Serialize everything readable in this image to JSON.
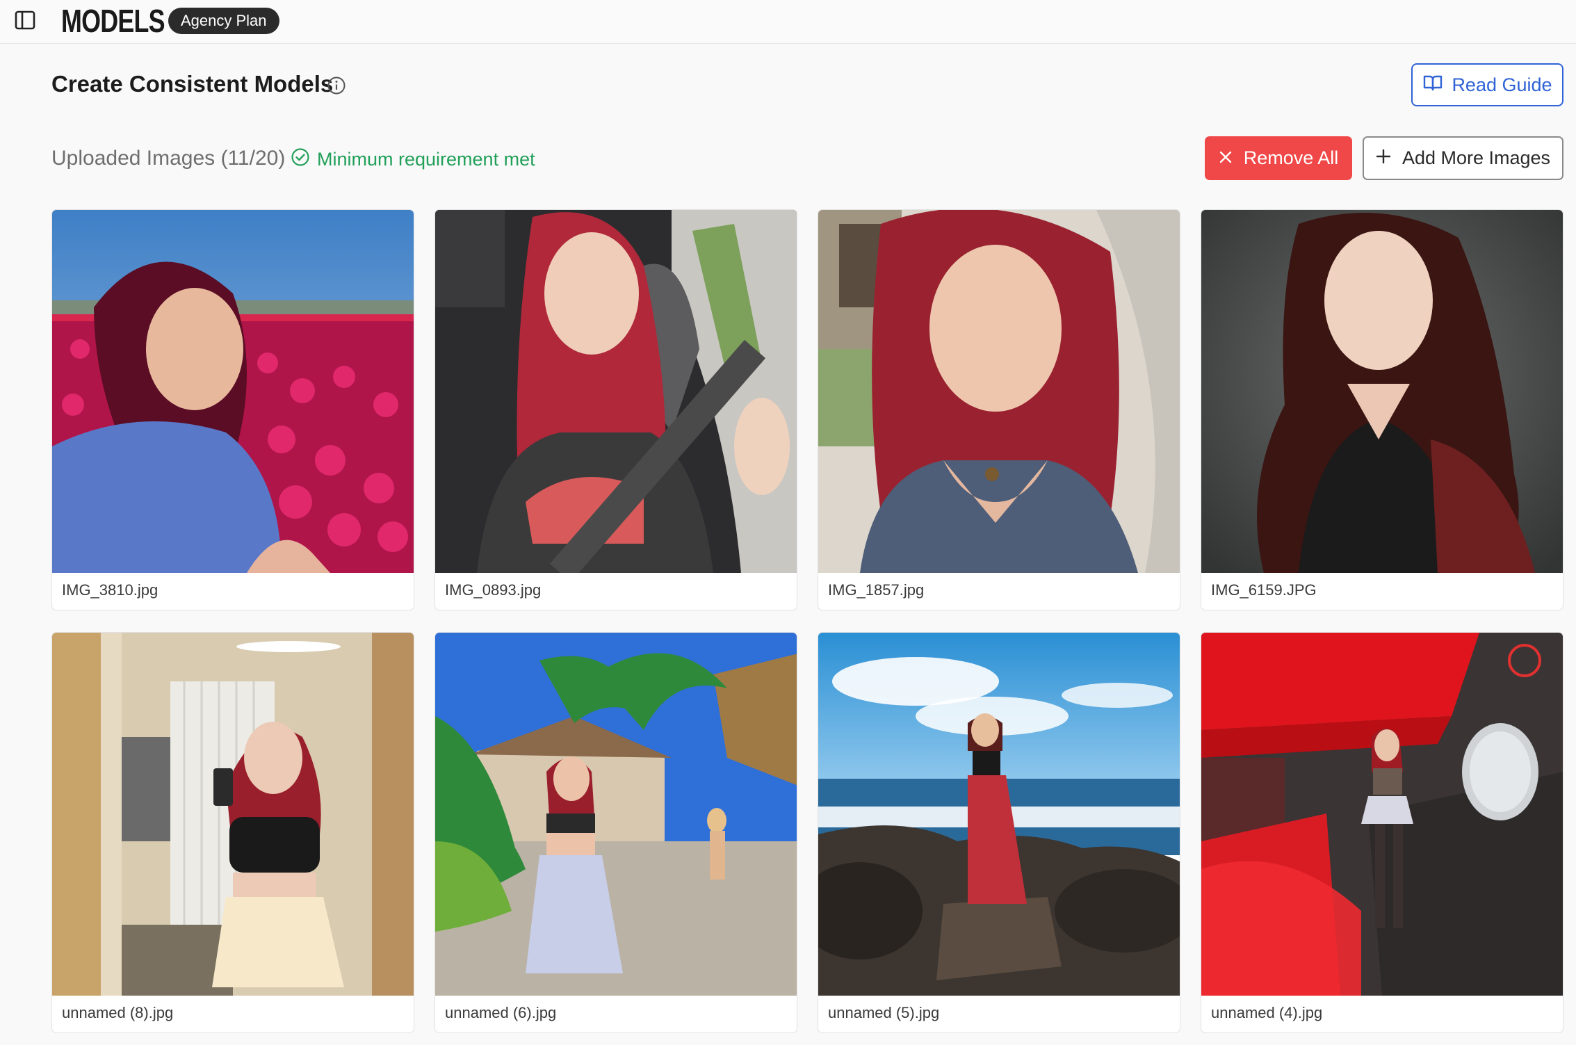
{
  "header": {
    "brand": "MODELS",
    "plan_badge": "Agency Plan"
  },
  "page": {
    "title": "Create Consistent Models",
    "read_guide_label": "Read Guide"
  },
  "uploads": {
    "label": "Uploaded Images (11/20)",
    "requirement_status": "Minimum requirement met",
    "remove_all_label": "Remove All",
    "add_more_label": "Add More Images"
  },
  "images": [
    {
      "filename": "IMG_3810.jpg"
    },
    {
      "filename": "IMG_0893.jpg"
    },
    {
      "filename": "IMG_1857.jpg"
    },
    {
      "filename": "IMG_6159.JPG"
    },
    {
      "filename": "unnamed (8).jpg"
    },
    {
      "filename": "unnamed (6).jpg"
    },
    {
      "filename": "unnamed (5).jpg"
    },
    {
      "filename": "unnamed (4).jpg"
    }
  ],
  "colors": {
    "accent_blue": "#2f63d6",
    "danger_red": "#f04848",
    "success_green": "#22a05a"
  }
}
